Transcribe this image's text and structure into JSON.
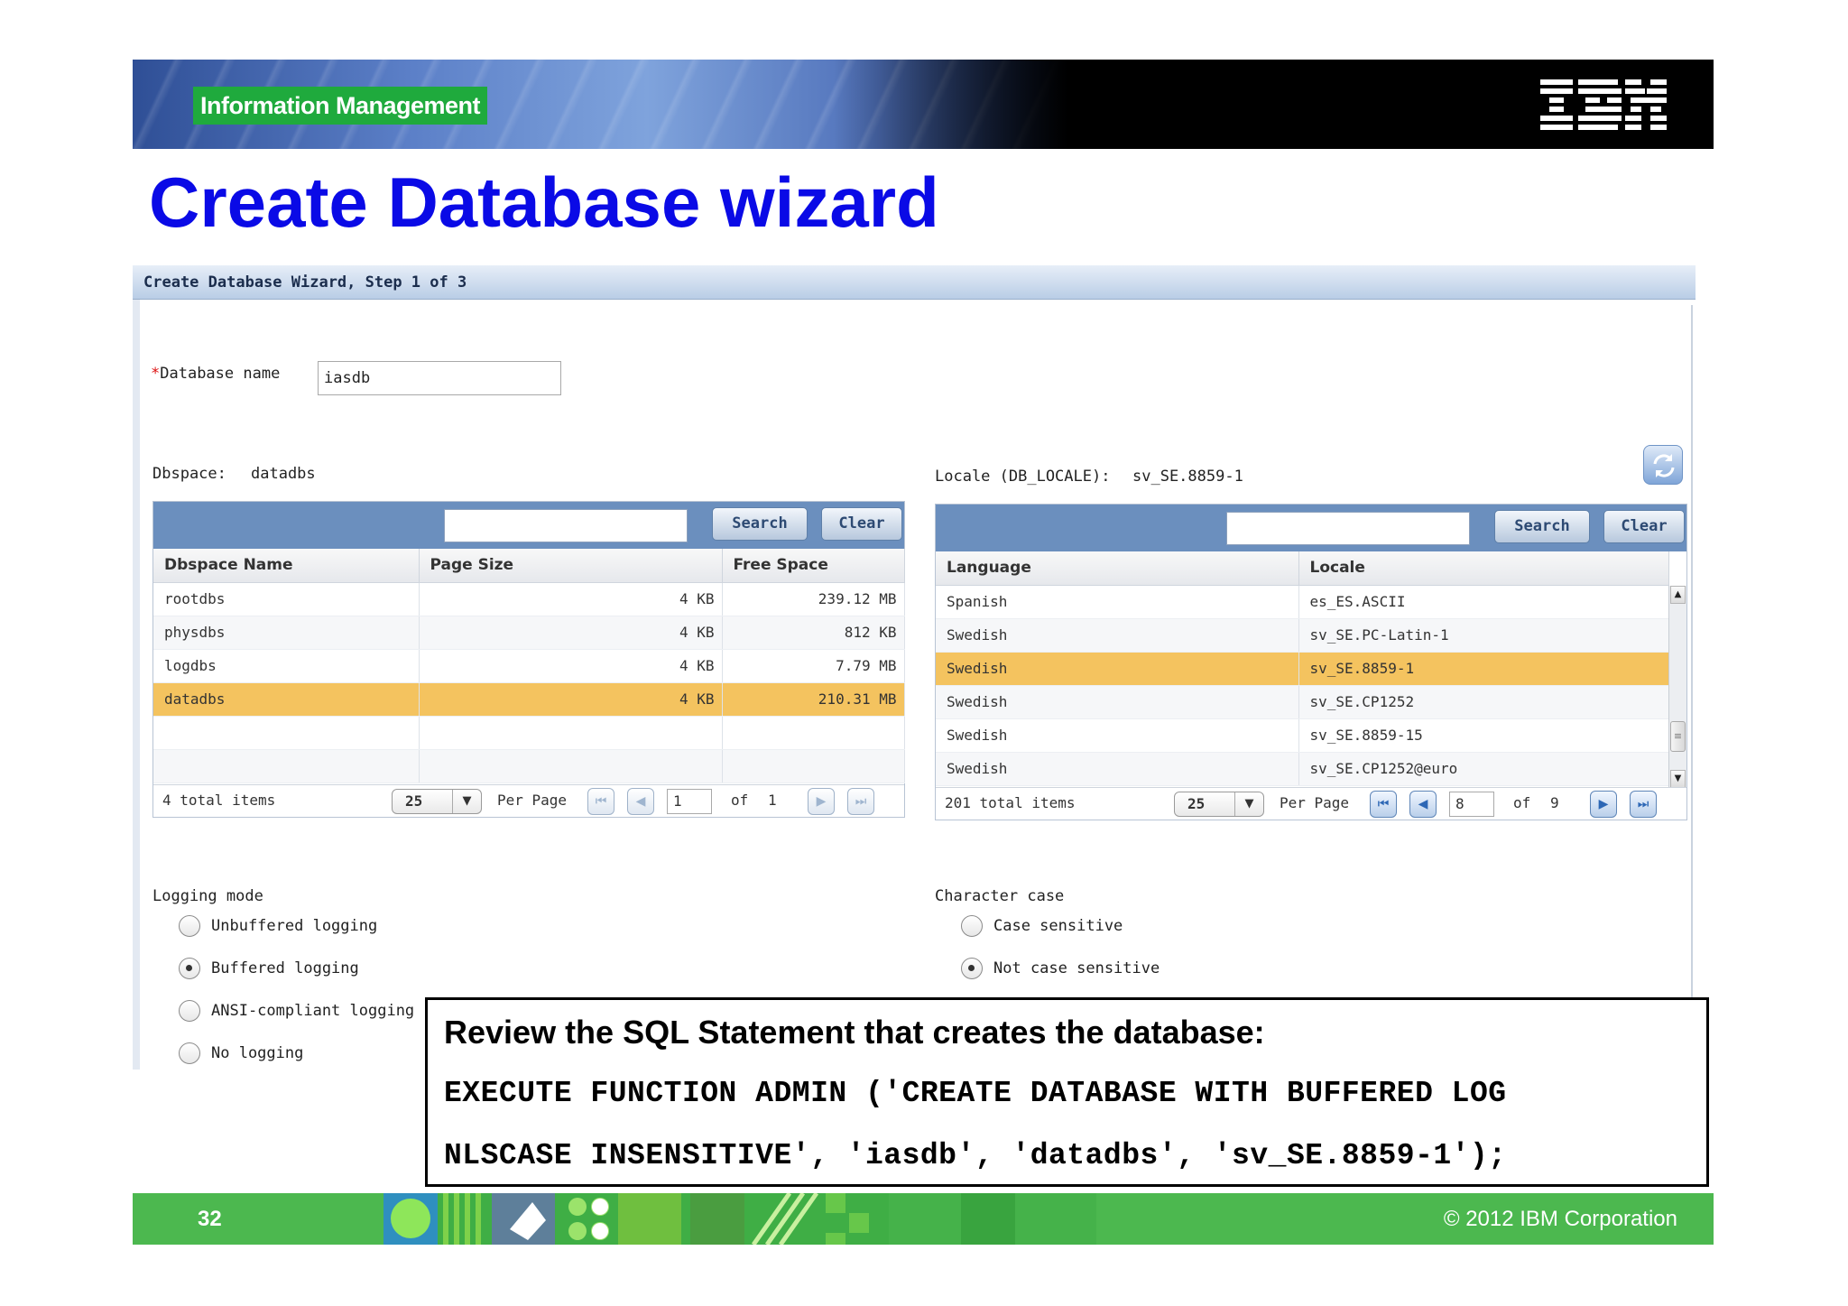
{
  "banner": {
    "section_label": "Information Management",
    "logo_text": "IBM"
  },
  "slide": {
    "title": "Create Database wizard",
    "page_number": "32",
    "copyright": "© 2012 IBM Corporation"
  },
  "wizard": {
    "title": "Create Database Wizard, Step 1 of 3",
    "database_name": {
      "required_mark": "*",
      "label": "Database name",
      "value": "iasdb"
    },
    "dbspace": {
      "label": "Dbspace:",
      "value": "datadbs"
    },
    "locale": {
      "label": "Locale (DB_LOCALE):",
      "value": "sv_SE.8859-1"
    },
    "dbspace_grid": {
      "search_value": "",
      "search_button": "Search",
      "clear_button": "Clear",
      "columns": [
        "Dbspace Name",
        "Page Size",
        "Free Space"
      ],
      "rows": [
        [
          "rootdbs",
          "4 KB",
          "239.12 MB"
        ],
        [
          "physdbs",
          "4 KB",
          "812 KB"
        ],
        [
          "logdbs",
          "4 KB",
          "7.79 MB"
        ],
        [
          "datadbs",
          "4 KB",
          "210.31 MB"
        ]
      ],
      "selected_row": 3,
      "footer": {
        "total_items": "4 total items",
        "per_page_value": "25",
        "per_page_label": "Per Page",
        "current_page": "1",
        "of_label": "of",
        "page_count": "1"
      }
    },
    "locale_grid": {
      "search_value": "",
      "search_button": "Search",
      "clear_button": "Clear",
      "columns": [
        "Language",
        "Locale"
      ],
      "rows": [
        [
          "Spanish",
          "es_ES.ASCII"
        ],
        [
          "Swedish",
          "sv_SE.PC-Latin-1"
        ],
        [
          "Swedish",
          "sv_SE.8859-1"
        ],
        [
          "Swedish",
          "sv_SE.CP1252"
        ],
        [
          "Swedish",
          "sv_SE.8859-15"
        ],
        [
          "Swedish",
          "sv_SE.CP1252@euro"
        ]
      ],
      "selected_row": 2,
      "footer": {
        "total_items": "201 total items",
        "per_page_value": "25",
        "per_page_label": "Per Page",
        "current_page": "8",
        "of_label": "of",
        "page_count": "9"
      }
    },
    "logging_mode": {
      "label": "Logging mode",
      "options": [
        "Unbuffered logging",
        "Buffered logging",
        "ANSI-compliant logging",
        "No logging"
      ],
      "selected": "Buffered logging"
    },
    "character_case": {
      "label": "Character case",
      "options": [
        "Case sensitive",
        "Not case sensitive"
      ],
      "selected": "Not case sensitive"
    }
  },
  "sql_callout": {
    "heading": "Review the SQL Statement that creates the database:",
    "line1": "EXECUTE FUNCTION ADMIN ('CREATE DATABASE WITH BUFFERED LOG",
    "line2": "NLSCASE INSENSITIVE', 'iasdb', 'datadbs', 'sv_SE.8859-1');"
  },
  "colors": {
    "title_blue": "#0a0ae6",
    "selection": "#f4c35f",
    "grid_toolbar": "#6b8fbe",
    "footer_green": "#4cb84f",
    "label_green": "#1faa3d"
  }
}
